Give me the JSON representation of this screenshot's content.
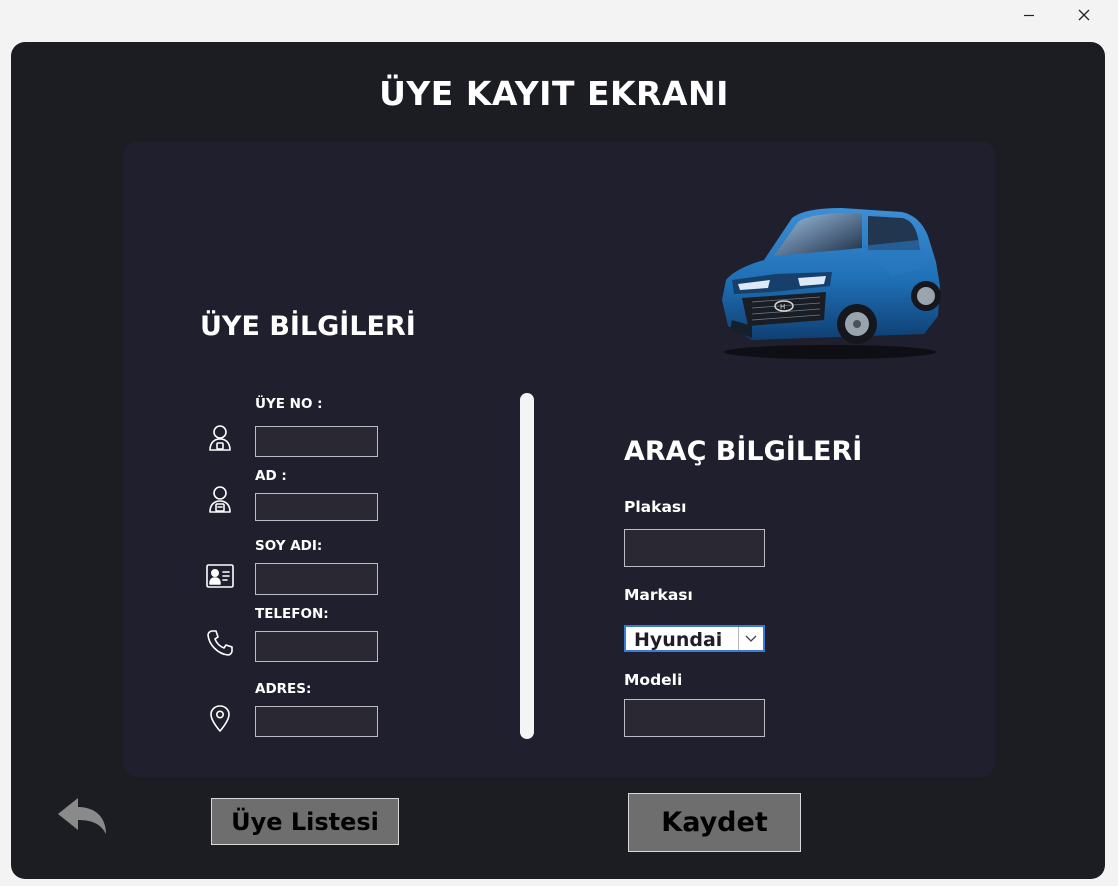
{
  "window": {
    "controls": {
      "minimize_icon": "minimize-icon",
      "close_icon": "close-icon"
    },
    "title": "ÜYE KAYIT EKRANI"
  },
  "member_section": {
    "title": "ÜYE BİLGİLERİ",
    "fields": [
      {
        "label": "ÜYE NO :",
        "value": "",
        "icon": "member-id-icon"
      },
      {
        "label": "AD :",
        "value": "",
        "icon": "user-icon"
      },
      {
        "label": "SOY ADI:",
        "value": "",
        "icon": "id-card-icon"
      },
      {
        "label": "TELEFON:",
        "value": "",
        "icon": "phone-icon"
      },
      {
        "label": "ADRES:",
        "value": "",
        "icon": "location-pin-icon"
      }
    ]
  },
  "vehicle_section": {
    "title": "ARAÇ BİLGİLERİ",
    "plate": {
      "label": "Plakası",
      "value": ""
    },
    "brand": {
      "label": "Markası",
      "selected": "Hyundai"
    },
    "model": {
      "label": "Modeli",
      "value": ""
    },
    "image": "blue-suv-car-image"
  },
  "buttons": {
    "back_icon": "back-arrow-icon",
    "member_list": "Üye Listesi",
    "save": "Kaydet"
  },
  "colors": {
    "window_bg": "#1c1d22",
    "panel_bg": "#1f1f2e",
    "input_bg": "#292833",
    "button_bg": "#6e6e6e",
    "select_border": "#3a7bd5",
    "car_body": "#1f6fb5"
  }
}
